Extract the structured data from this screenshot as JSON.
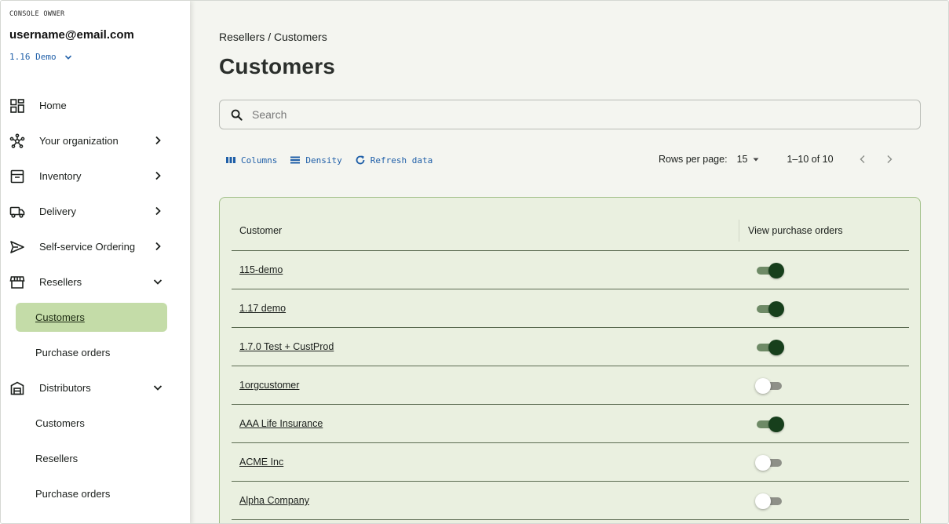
{
  "sidebar": {
    "owner_label": "CONSOLE OWNER",
    "email": "username@email.com",
    "version": "1.16 Demo",
    "items": [
      {
        "label": "Home",
        "icon": "dashboard-icon"
      },
      {
        "label": "Your organization",
        "icon": "org-network-icon"
      },
      {
        "label": "Inventory",
        "icon": "inventory-box-icon"
      },
      {
        "label": "Delivery",
        "icon": "truck-icon"
      },
      {
        "label": "Self-service Ordering",
        "icon": "send-icon"
      },
      {
        "label": "Resellers",
        "icon": "storefront-icon"
      },
      {
        "label": "Distributors",
        "icon": "warehouse-icon"
      }
    ],
    "resellers_sub": [
      "Customers",
      "Purchase orders"
    ],
    "distributors_sub": [
      "Customers",
      "Resellers",
      "Purchase orders"
    ]
  },
  "main": {
    "breadcrumb": "Resellers / Customers",
    "title": "Customers",
    "search_placeholder": "Search",
    "toolbar": {
      "columns": "Columns",
      "density": "Density",
      "refresh": "Refresh data"
    },
    "pager": {
      "rows_label": "Rows per page:",
      "rows_value": "15",
      "range": "1–10 of 10"
    },
    "table": {
      "headers": [
        "Customer",
        "View purchase orders"
      ],
      "rows": [
        {
          "customer": "115-demo",
          "view_po": true
        },
        {
          "customer": "1.17 demo",
          "view_po": true
        },
        {
          "customer": "1.7.0 Test + CustProd",
          "view_po": true
        },
        {
          "customer": "1orgcustomer",
          "view_po": false
        },
        {
          "customer": "AAA Life Insurance",
          "view_po": true
        },
        {
          "customer": "ACME Inc",
          "view_po": false
        },
        {
          "customer": "Alpha Company",
          "view_po": false
        }
      ]
    }
  },
  "colors": {
    "accent_link": "#1f5fa8",
    "active_nav": "#c4dca8",
    "toggle_on": "#173f1c",
    "table_bg": "#eaf0e0"
  }
}
